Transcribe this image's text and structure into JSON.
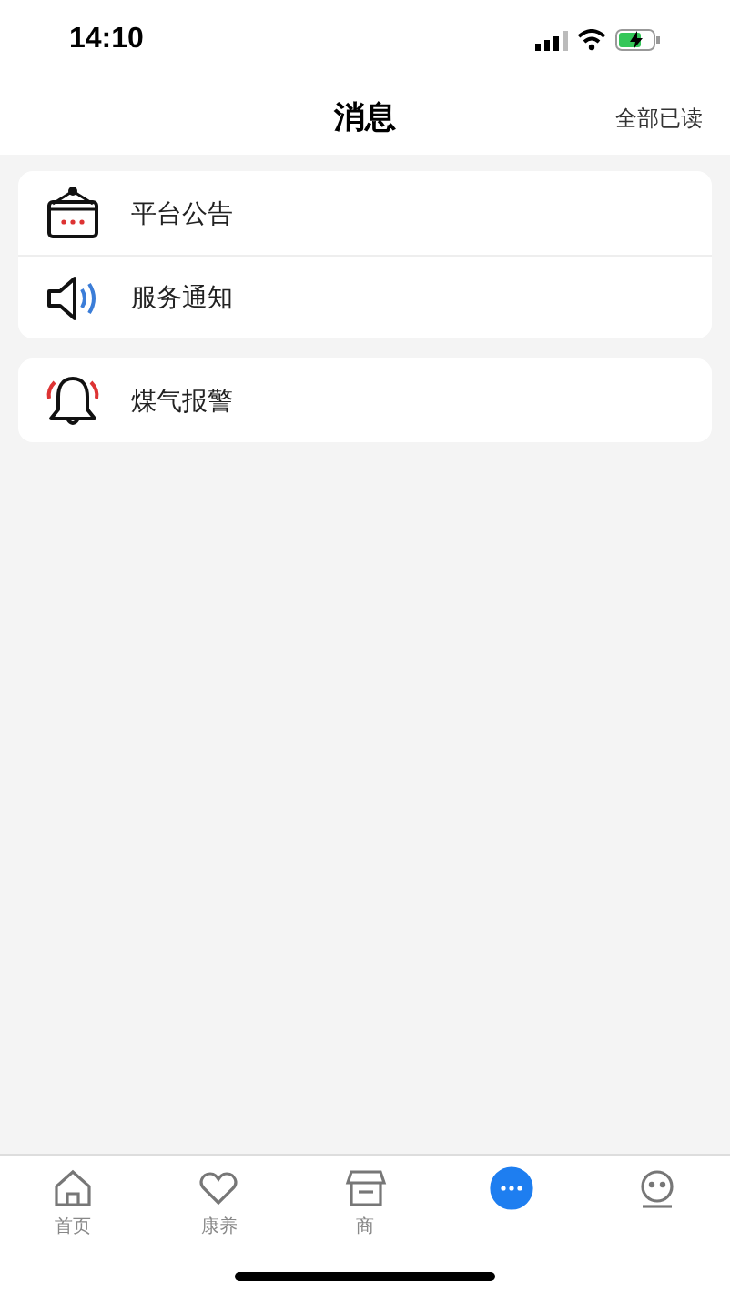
{
  "status_bar": {
    "time": "14:10"
  },
  "header": {
    "title": "消息",
    "action": "全部已读"
  },
  "groups": [
    {
      "items": [
        {
          "kind": "notice",
          "label": "平台公告"
        },
        {
          "kind": "service",
          "label": "服务通知"
        }
      ]
    },
    {
      "items": [
        {
          "kind": "alarm",
          "label": "煤气报警"
        }
      ]
    }
  ],
  "tab_bar": [
    {
      "kind": "home",
      "label": "首页",
      "selected": false
    },
    {
      "kind": "heart",
      "label": "康养",
      "selected": false
    },
    {
      "kind": "shop",
      "label": "商",
      "selected": false
    },
    {
      "kind": "chat",
      "selected": true
    },
    {
      "kind": "face",
      "selected": false
    }
  ]
}
